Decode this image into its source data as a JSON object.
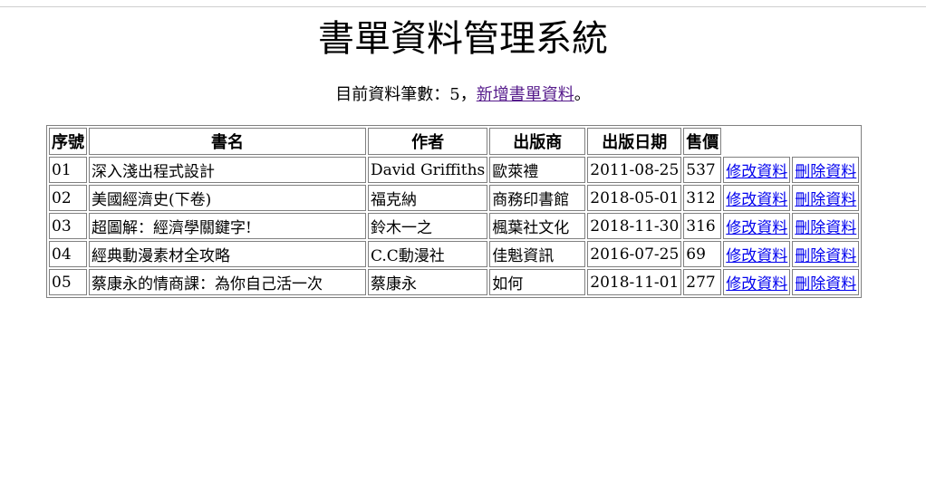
{
  "title": "書單資料管理系統",
  "summary": {
    "prefix": "目前資料筆數：",
    "count": "5",
    "separator": "，",
    "add_link": "新增書單資料",
    "suffix": "。"
  },
  "table": {
    "headers": [
      "序號",
      "書名",
      "作者",
      "出版商",
      "出版日期",
      "售價"
    ],
    "edit_label": "修改資料",
    "delete_label": "刪除資料",
    "rows": [
      {
        "id": "01",
        "title": "深入淺出程式設計",
        "author": "David Griffiths",
        "publisher": "歐萊禮",
        "date": "2011-08-25",
        "price": "537"
      },
      {
        "id": "02",
        "title": "美國經濟史(下卷)",
        "author": "福克納",
        "publisher": "商務印書館",
        "date": "2018-05-01",
        "price": "312"
      },
      {
        "id": "03",
        "title": "超圖解：經濟學關鍵字!",
        "author": "鈴木一之",
        "publisher": "楓葉社文化",
        "date": "2018-11-30",
        "price": "316"
      },
      {
        "id": "04",
        "title": "經典動漫素材全攻略",
        "author": "C.C動漫社",
        "publisher": "佳魁資訊",
        "date": "2016-07-25",
        "price": "69"
      },
      {
        "id": "05",
        "title": "蔡康永的情商課：為你自己活一次",
        "author": "蔡康永",
        "publisher": "如何",
        "date": "2018-11-01",
        "price": "277"
      }
    ]
  }
}
